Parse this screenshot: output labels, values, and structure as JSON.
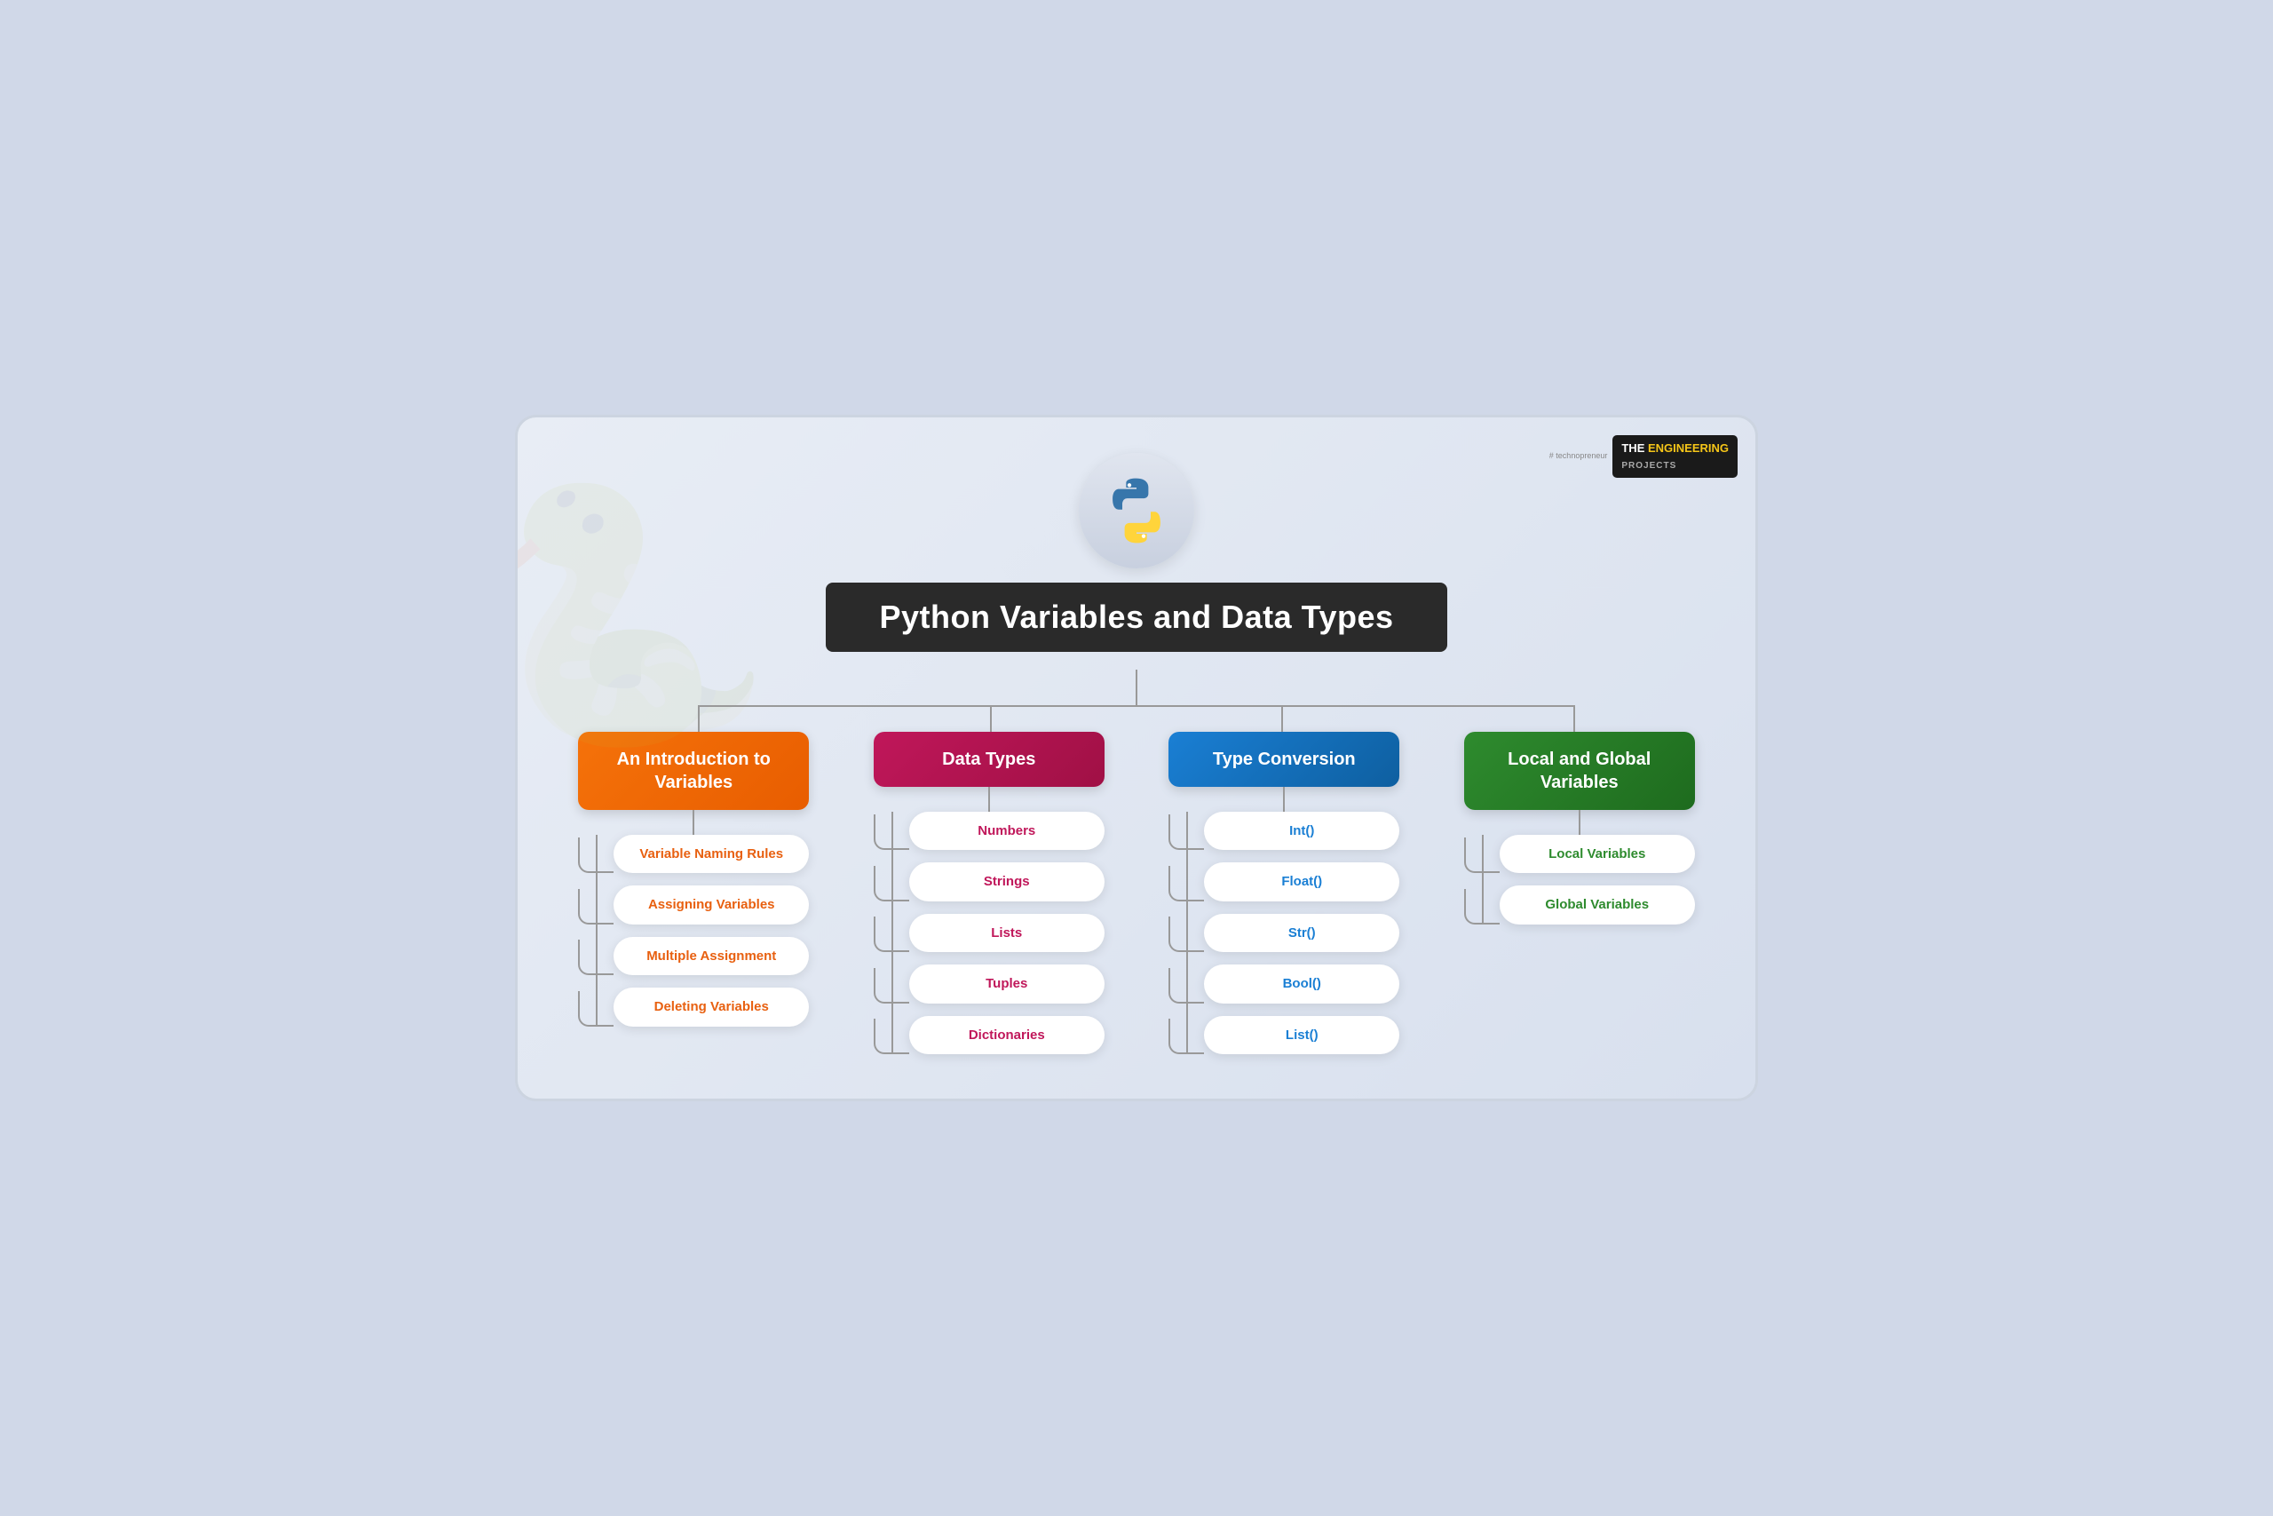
{
  "brand": {
    "hashtag": "# technopreneur",
    "the": "THE",
    "name": "ENGINEERING",
    "projects": "PROJECTS"
  },
  "title": "Python Variables and Data Types",
  "categories": [
    {
      "id": "intro",
      "label": "An Introduction to\nVariables",
      "color": "orange",
      "items": [
        "Variable Naming Rules",
        "Assigning Variables",
        "Multiple Assignment",
        "Deleting Variables"
      ]
    },
    {
      "id": "datatypes",
      "label": "Data Types",
      "color": "red",
      "items": [
        "Numbers",
        "Strings",
        "Lists",
        "Tuples",
        "Dictionaries"
      ]
    },
    {
      "id": "typeconv",
      "label": "Type Conversion",
      "color": "blue",
      "items": [
        "Int()",
        "Float()",
        "Str()",
        "Bool()",
        "List()"
      ]
    },
    {
      "id": "localglob",
      "label": "Local and Global\nVariables",
      "color": "green",
      "items": [
        "Local Variables",
        "Global Variables"
      ]
    }
  ]
}
